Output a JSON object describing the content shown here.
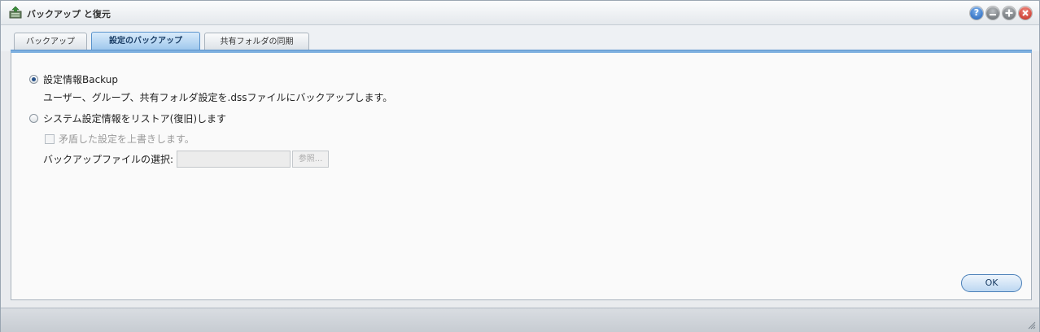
{
  "window": {
    "title": "バックアップ と復元",
    "icon": "backup-restore-app-icon",
    "controls": [
      "help-icon",
      "minimize-icon",
      "maximize-icon",
      "close-icon"
    ]
  },
  "tabs": [
    {
      "label": "バックアップ",
      "active": false
    },
    {
      "label": "設定のバックアップ",
      "active": true
    },
    {
      "label": "共有フォルダの同期",
      "active": false
    }
  ],
  "options": {
    "backup": {
      "label": "設定情報Backup",
      "description": "ユーザー、グループ、共有フォルダ設定を.dssファイルにバックアップします。",
      "selected": true
    },
    "restore": {
      "label": "システム設定情報をリストア(復旧)します",
      "selected": false
    },
    "overwrite": {
      "label": "矛盾した設定を上書きします。",
      "checked": false,
      "enabled": false
    },
    "file_select": {
      "label": "バックアップファイルの選択:",
      "value": "",
      "browse_label": "参照..."
    }
  },
  "footer": {
    "ok_label": "OK"
  },
  "colors": {
    "accent": "#5a93cc",
    "active_tab_bg": "#9cc6ec",
    "close_button": "#c0281c",
    "help_button": "#1f5fb6"
  }
}
